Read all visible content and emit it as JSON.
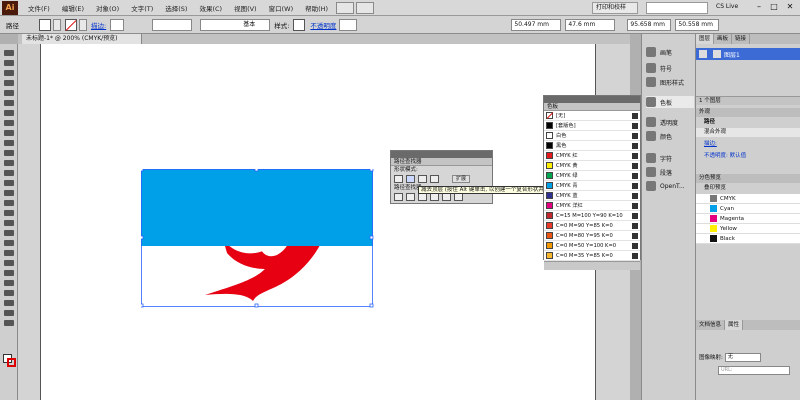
{
  "app": {
    "logo": "Ai",
    "workspace": "打印和校样",
    "cs_live": "CS Live"
  },
  "menu": [
    "文件(F)",
    "编辑(E)",
    "对象(O)",
    "文字(T)",
    "选择(S)",
    "效果(C)",
    "视图(V)",
    "窗口(W)",
    "帮助(H)"
  ],
  "control": {
    "selection_label": "路径",
    "stroke_label": "描边:",
    "brush_value": "基本",
    "style_label": "样式:",
    "opacity_label": "不透明度",
    "x_value": "50.497 mm",
    "y_value": "47.6 mm",
    "w_value": "95.658 mm",
    "h_value": "50.558 mm"
  },
  "document_tab": "未标题-1* @ 200% (CMYK/预览)",
  "pathfinder": {
    "tab": "路径查找器",
    "shape_modes": "形状模式:",
    "pathfinders": "路径查找器:",
    "expand": "扩展",
    "tooltip": "减去顶层 (按住 Alt 键单击, 以创建一个复合形状并减去顶层)"
  },
  "swatches": {
    "tab": "色板",
    "rows": [
      {
        "name": "[无]",
        "color": "none"
      },
      {
        "name": "[套版色]",
        "color": "#000000"
      },
      {
        "name": "白色",
        "color": "#ffffff"
      },
      {
        "name": "黑色",
        "color": "#000000"
      },
      {
        "name": "CMYK 红",
        "color": "#e4191d"
      },
      {
        "name": "CMYK 黄",
        "color": "#ffef00"
      },
      {
        "name": "CMYK 绿",
        "color": "#00a550"
      },
      {
        "name": "CMYK 青",
        "color": "#00a0e9"
      },
      {
        "name": "CMYK 蓝",
        "color": "#2e3192"
      },
      {
        "name": "CMYK 洋红",
        "color": "#e4007f"
      },
      {
        "name": "C=15 M=100 Y=90 K=10",
        "color": "#c1272d"
      },
      {
        "name": "C=0 M=90 Y=85 K=0",
        "color": "#e83a2a"
      },
      {
        "name": "C=0 M=80 Y=95 K=0",
        "color": "#ea5514"
      },
      {
        "name": "C=0 M=50 Y=100 K=0",
        "color": "#f39800"
      },
      {
        "name": "C=0 M=35 Y=85 K=0",
        "color": "#f8b62d"
      }
    ]
  },
  "dock": {
    "items": [
      "画笔",
      "符号",
      "图形样式",
      "色板",
      "透明度",
      "颜色",
      "字符",
      "段落",
      "OpenT..."
    ],
    "active_index": 3
  },
  "layers": {
    "tabs": [
      "图层",
      "画板",
      "链接"
    ],
    "layer_name": "图层1",
    "footer": "1 个图层"
  },
  "appearance": {
    "tab": "外观",
    "title": "路径",
    "row1": "混合外观",
    "stroke": "描边:",
    "opacity": "不透明度: 默认值"
  },
  "separations": {
    "tab": "分色预览",
    "overprint": "叠印预览",
    "rows": [
      {
        "name": "CMYK",
        "color": "#777777"
      },
      {
        "name": "Cyan",
        "color": "#00a0e9"
      },
      {
        "name": "Magenta",
        "color": "#e4007f"
      },
      {
        "name": "Yellow",
        "color": "#ffef00"
      },
      {
        "name": "Black",
        "color": "#111111"
      }
    ]
  },
  "attributes": {
    "tabs": [
      "文档信息",
      "属性"
    ],
    "image_map_label": "图像映射:",
    "image_map_value": "无",
    "url_placeholder": "URL:"
  },
  "artwork": {
    "blue": "#00a0e9",
    "red": "#e60012"
  }
}
